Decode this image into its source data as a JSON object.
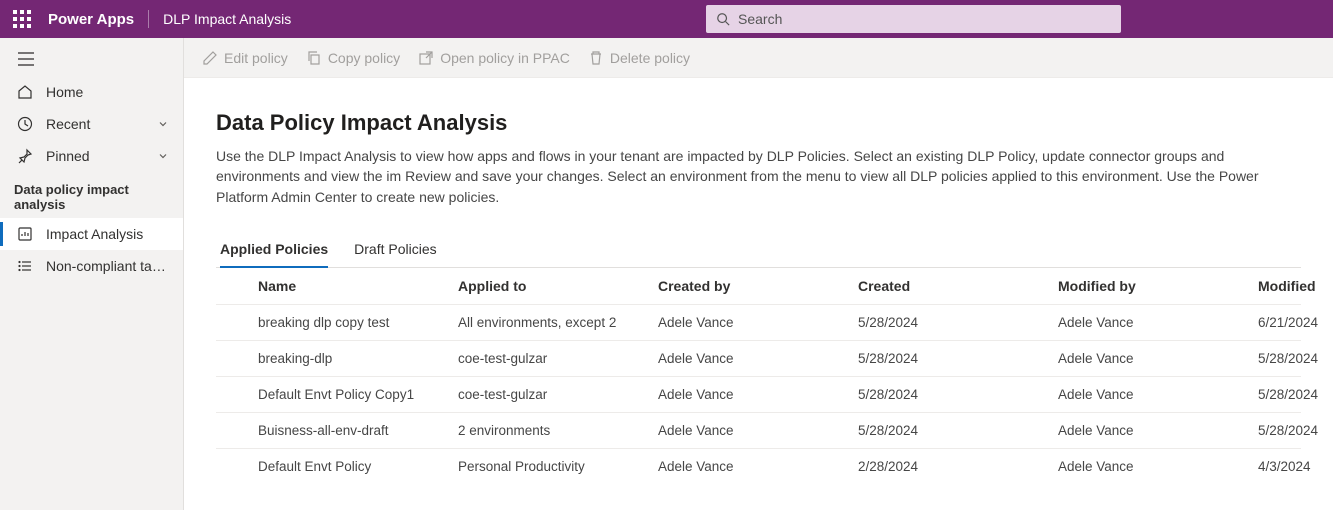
{
  "header": {
    "app_name": "Power Apps",
    "page_name": "DLP Impact Analysis",
    "search_placeholder": "Search"
  },
  "sidebar": {
    "items": [
      {
        "icon": "home",
        "label": "Home",
        "chevron": false
      },
      {
        "icon": "clock",
        "label": "Recent",
        "chevron": true
      },
      {
        "icon": "pin",
        "label": "Pinned",
        "chevron": true
      }
    ],
    "section_title": "Data policy impact analysis",
    "section_items": [
      {
        "icon": "chart",
        "label": "Impact Analysis",
        "active": true
      },
      {
        "icon": "list",
        "label": "Non-compliant task l...",
        "active": false
      }
    ]
  },
  "cmdbar": {
    "items": [
      {
        "icon": "edit",
        "label": "Edit policy"
      },
      {
        "icon": "copy",
        "label": "Copy policy"
      },
      {
        "icon": "open",
        "label": "Open policy in PPAC"
      },
      {
        "icon": "delete",
        "label": "Delete policy"
      }
    ]
  },
  "main": {
    "title": "Data Policy Impact Analysis",
    "desc": "Use the DLP Impact Analysis to view how apps and flows in your tenant are impacted by DLP Policies. Select an existing DLP Policy, update connector groups and environments and view the im Review and save your changes. Select an environment from the menu to view all DLP policies applied to this environment. Use the Power Platform Admin Center to create new policies."
  },
  "tabs": {
    "items": [
      {
        "label": "Applied Policies",
        "active": true
      },
      {
        "label": "Draft Policies",
        "active": false
      }
    ]
  },
  "table": {
    "headers": [
      "Name",
      "Applied to",
      "Created by",
      "Created",
      "Modified by",
      "Modified"
    ],
    "rows": [
      [
        "breaking dlp copy test",
        "All environments, except 2",
        "Adele Vance",
        "5/28/2024",
        "Adele Vance",
        "6/21/2024"
      ],
      [
        "breaking-dlp",
        "coe-test-gulzar",
        "Adele Vance",
        "5/28/2024",
        "Adele Vance",
        "5/28/2024"
      ],
      [
        "Default Envt Policy Copy1",
        "coe-test-gulzar",
        "Adele Vance",
        "5/28/2024",
        "Adele Vance",
        "5/28/2024"
      ],
      [
        "Buisness-all-env-draft",
        "2 environments",
        "Adele Vance",
        "5/28/2024",
        "Adele Vance",
        "5/28/2024"
      ],
      [
        "Default Envt Policy",
        "Personal Productivity",
        "Adele Vance",
        "2/28/2024",
        "Adele Vance",
        "4/3/2024"
      ]
    ]
  }
}
